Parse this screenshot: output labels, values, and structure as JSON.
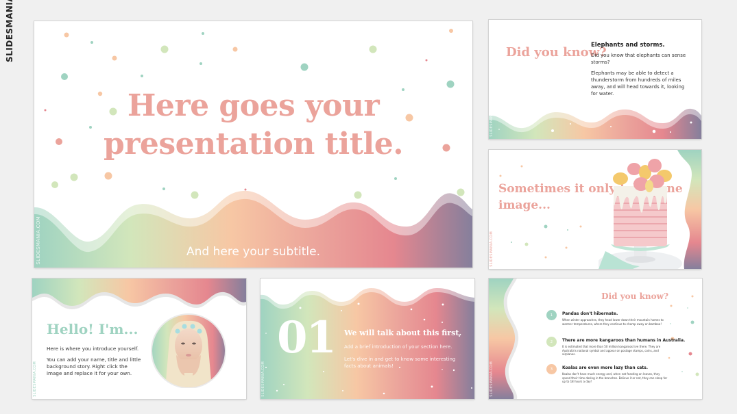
{
  "brand": {
    "name": "SLIDESMANIA",
    "watermark": "SLIDESMANIA.COM"
  },
  "colors": {
    "pink": "#eba39b",
    "mint": "#9fd3c1",
    "green": "#d2e6bb",
    "peach": "#f7c7a4",
    "coral": "#e5878f",
    "purple": "#857f9c"
  },
  "slides": [
    {
      "id": "title",
      "title": "Here goes your presentation title.",
      "subtitle": "And here your subtitle."
    },
    {
      "id": "did-you-know",
      "title": "Did you know?",
      "heading": "Elephants and storms.",
      "paragraphs": [
        "Did you know that elephants can sense storms?",
        "Elephants may be able to detect a thunderstorm from hundreds of miles away, and will head towards it, looking for water."
      ]
    },
    {
      "id": "one-image",
      "title": "Sometimes it only takes one image...",
      "image": "cake-photo"
    },
    {
      "id": "hello",
      "title": "Hello! I'm...",
      "image": "portrait-photo",
      "paragraphs": [
        "Here is where you introduce yourself.",
        "You can add your name, title and little background story. Right click the image and replace it for your own."
      ]
    },
    {
      "id": "section",
      "number": "01",
      "title": "We will talk about this first.",
      "paragraphs": [
        "Add a brief introduction of your section here.",
        "Let's dive in and get to know some interesting facts about animals!"
      ]
    },
    {
      "id": "facts",
      "title": "Did you know?",
      "items": [
        {
          "num": "1",
          "heading": "Pandas don't hibernate.",
          "text": "When winter approaches, they head lower down their mountain homes to warmer temperatures, where they continue to chomp away on bamboo!",
          "color": "#9fd3c1"
        },
        {
          "num": "2",
          "heading": "There are more kangaroos than humans in Australia.",
          "text": "It is estimated that more than 50 million kangaroos live there. They are Australia's national symbol and appear on postage stamps, coins, and airplanes.",
          "color": "#d2e6bb"
        },
        {
          "num": "3",
          "heading": "Koalas are even more lazy than cats.",
          "text": "Koalas don't have much energy and, when not feasting on leaves, they spend their time dozing in the branches. Believe it or not, they can sleep for up to 18 hours a day!",
          "color": "#f7c7a4"
        }
      ]
    }
  ]
}
